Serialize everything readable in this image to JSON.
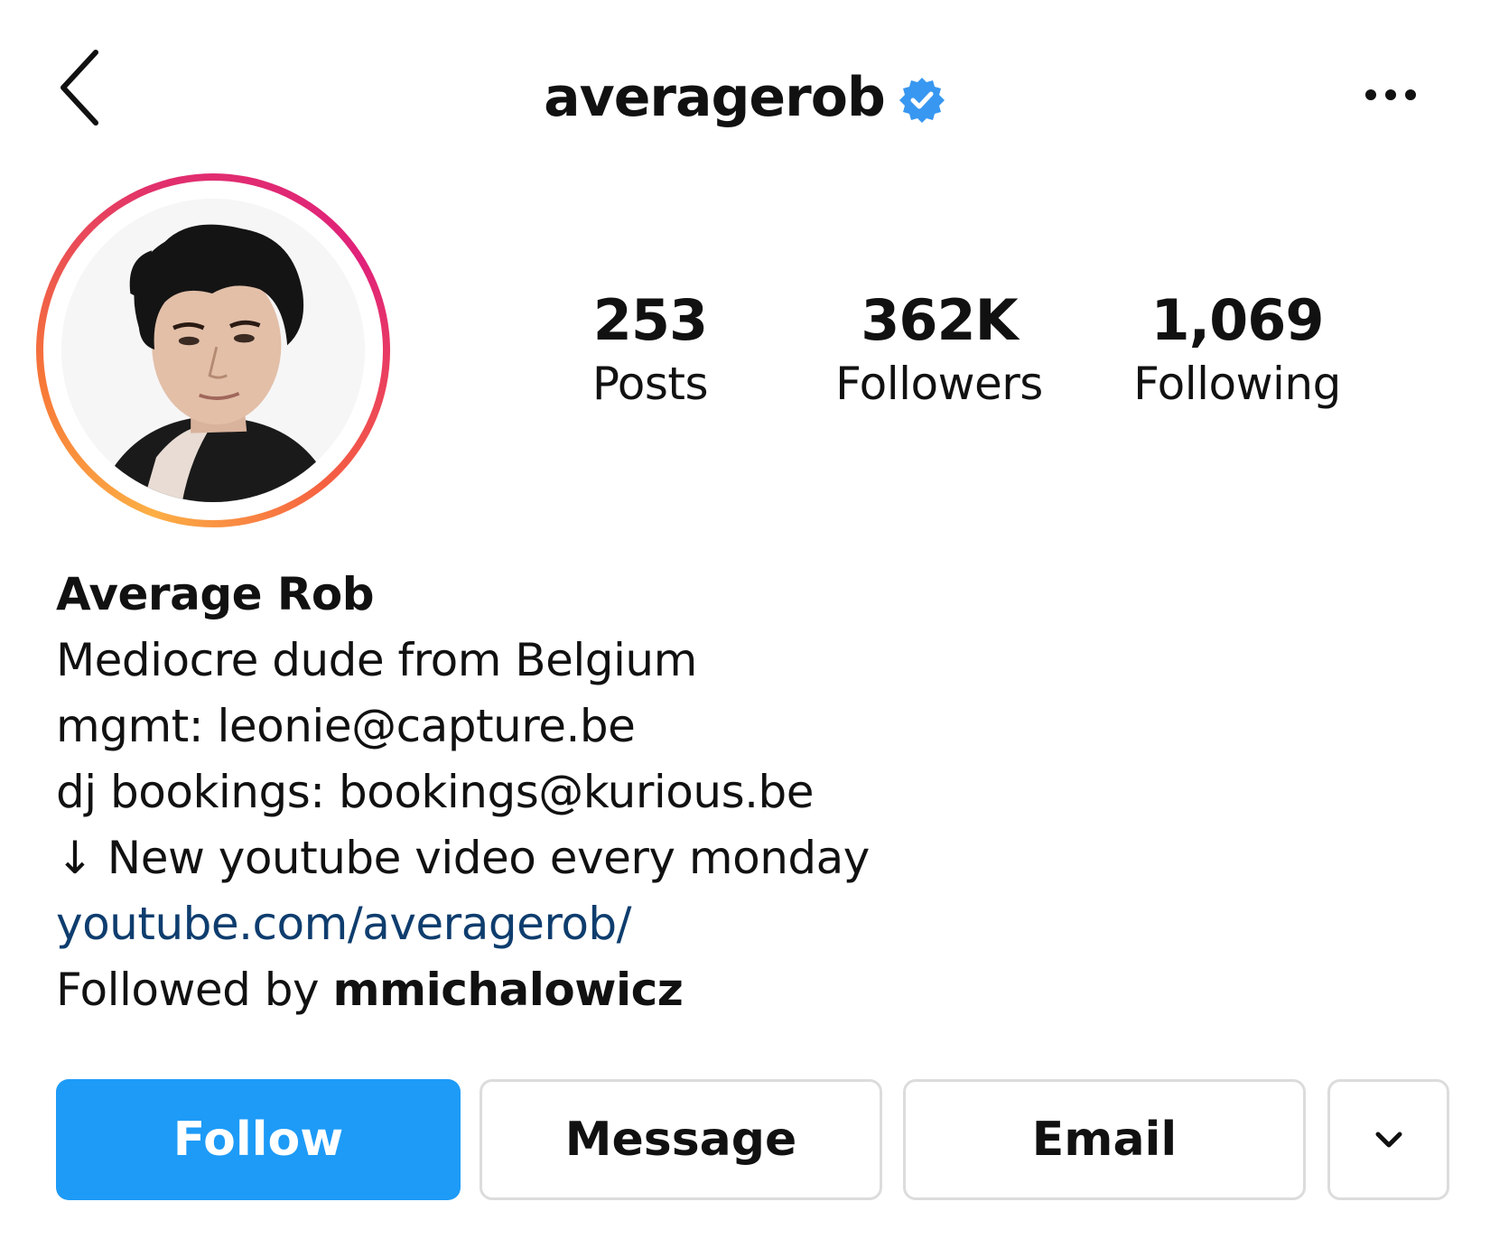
{
  "header": {
    "username": "averagerob",
    "verified": true,
    "accent_color": "#3897f0"
  },
  "profile": {
    "avatar_icon": "profile-photo",
    "story_ring_colors": [
      "#fcaf45",
      "#f77737",
      "#e1306c"
    ]
  },
  "stats": [
    {
      "value": "253",
      "label": "Posts"
    },
    {
      "value": "362K",
      "label": "Followers"
    },
    {
      "value": "1,069",
      "label": "Following"
    }
  ],
  "bio": {
    "name": "Average Rob",
    "lines": [
      "Mediocre dude from Belgium",
      "mgmt: leonie@capture.be",
      "dj bookings: bookings@kurious.be",
      "↓ New youtube video every monday"
    ],
    "link": "youtube.com/averagerob/",
    "followed_by_prefix": "Followed by ",
    "followed_by_user": "mmichalowicz"
  },
  "actions": {
    "follow_label": "Follow",
    "message_label": "Message",
    "email_label": "Email",
    "more_icon": "chevron-down-icon",
    "follow_color": "#1d9bf7"
  }
}
